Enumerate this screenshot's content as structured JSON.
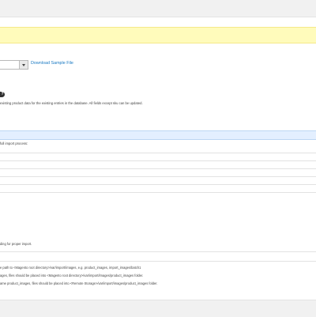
{
  "import": {
    "sample_link": "Download Sample File",
    "help_glyph": "?",
    "description": "existing product data for the existing entries in the database. All fields except sku can be updated.",
    "full_import_label": "full import process:"
  },
  "images": {
    "proper_import_note": "ding for proper import.",
    "lines": [
      "e path to <Magento root directory>/var/import/images, e.g. product_images, import_images/batch1",
      "ages, files should be placed into <Magento root directory>/var/import/images/product_images folder.",
      "ame product_images, files should be placed into <Remote Storage>/var/import/images/product_images folder."
    ]
  }
}
